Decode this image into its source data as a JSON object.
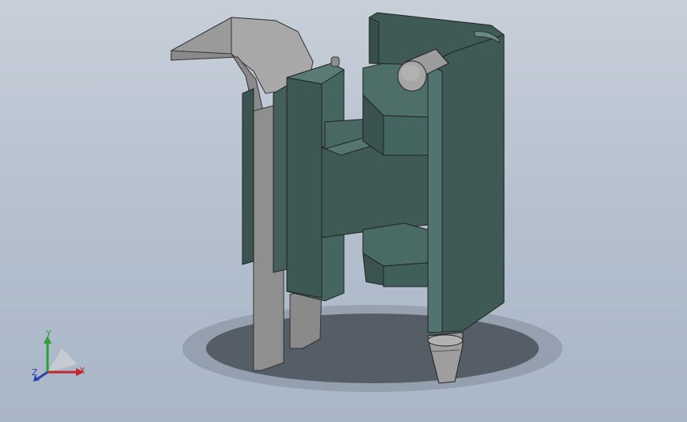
{
  "viewport": {
    "background_top": "#c7cfd9",
    "background_bottom": "#a9b6c6"
  },
  "model": {
    "body_color": "#3f5a55",
    "body_highlight": "#4f6d67",
    "body_shadow": "#2f4642",
    "clip_color": "#8c8c8c",
    "clip_highlight": "#b5b5b5",
    "pin_color": "#a6a6a6"
  },
  "triad": {
    "x_label": "X",
    "y_label": "Y",
    "z_label": "Z",
    "x_color": "#c0262c",
    "y_color": "#2d9e3a",
    "z_color": "#2b3fb5"
  }
}
